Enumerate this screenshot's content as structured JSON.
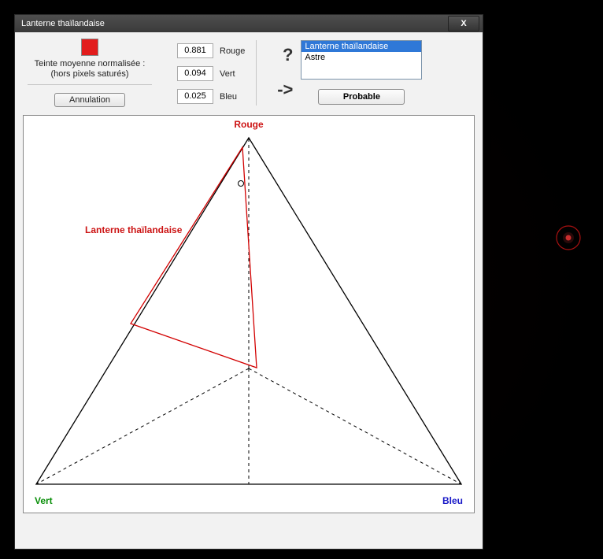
{
  "window": {
    "title": "Lanterne thaïlandaise",
    "close_glyph": "X"
  },
  "swatch_color": "#e21c1c",
  "hint_line1": "Teinte moyenne normalisée :",
  "hint_line2": "(hors pixels saturés)",
  "cancel_label": "Annulation",
  "rgb": {
    "r": {
      "value": "0.881",
      "label": "Rouge"
    },
    "g": {
      "value": "0.094",
      "label": "Vert"
    },
    "b": {
      "value": "0.025",
      "label": "Bleu"
    }
  },
  "symbols": {
    "question": "?",
    "arrow": "->"
  },
  "list": {
    "items": [
      "Lanterne thaïlandaise",
      "Astre"
    ],
    "selected_index": 0
  },
  "probable_label": "Probable",
  "chart_data": {
    "type": "ternary",
    "vertices": {
      "top": "Rouge",
      "left": "Vert",
      "right": "Bleu"
    },
    "region_label": "Lanterne thaïlandaise",
    "measured_point": {
      "r": 0.881,
      "g": 0.094,
      "b": 0.025
    },
    "region_polygon_approx": [
      {
        "r": 0.97,
        "g": 0.02,
        "b": 0.01
      },
      {
        "r": 0.42,
        "g": 0.2,
        "b": 0.38
      },
      {
        "r": 0.45,
        "g": 0.53,
        "b": 0.02
      }
    ]
  }
}
